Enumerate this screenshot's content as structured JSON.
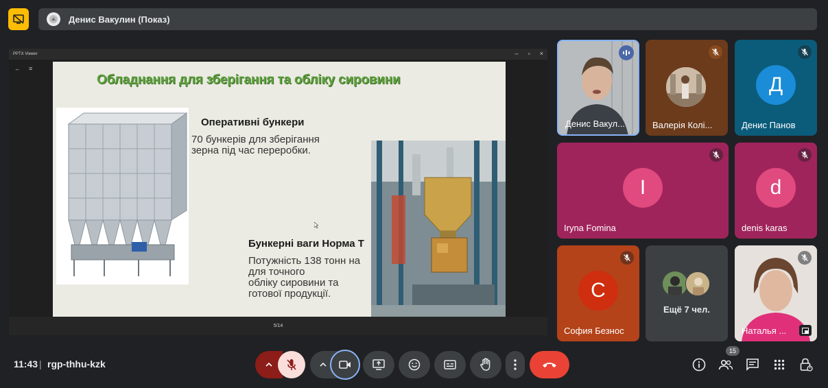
{
  "top": {
    "presenter_label": "Денис Вакулин (Показ)"
  },
  "shared_screen": {
    "window_title": "PPTX Viewer",
    "page_indicator": "5/14",
    "slide": {
      "title": "Обладнання для зберігання та обліку сировини",
      "heading1": "Оперативні бункери",
      "text1_line1": "70 бункерів для зберігання",
      "text1_line2": "зерна під час переробки.",
      "heading2": "Бункерні ваги Норма Т",
      "text2_line1": "Потужність 138 тонн на",
      "text2_line2": "для точного",
      "text2_line3": " обліку сировини та",
      "text2_line4": "готової продукції."
    }
  },
  "participants": [
    {
      "name": "Денис Вакул...",
      "type": "video"
    },
    {
      "name": "Валерія Колі...",
      "type": "photo",
      "muted": true
    },
    {
      "name": "Денис Панов",
      "type": "letter",
      "letter": "Д",
      "muted": true
    },
    {
      "name": "Iryna Fomina",
      "type": "letter",
      "letter": "I",
      "muted": true
    },
    {
      "name": "denis karas",
      "type": "letter",
      "letter": "d",
      "muted": true
    },
    {
      "name": "София Безнос",
      "type": "letter",
      "letter": "С",
      "muted": true
    },
    {
      "name": "Ещё 7 чел.",
      "type": "more"
    },
    {
      "name": "Наталья ...",
      "type": "video",
      "muted": true
    }
  ],
  "bottom": {
    "time": "11:43",
    "separator": "|",
    "meeting_code": "rgp-thhu-kzk",
    "participants_count": "15"
  },
  "colors": {
    "background": "#202124",
    "accent_yellow": "#fbbc04",
    "end_call": "#ea4335",
    "mic_off_red": "#f9dedc",
    "tile_magenta": "#a0245c",
    "tile_blue": "#0b5c7a",
    "tile_brown": "#6b3b1b",
    "tile_orange": "#b4431a"
  }
}
